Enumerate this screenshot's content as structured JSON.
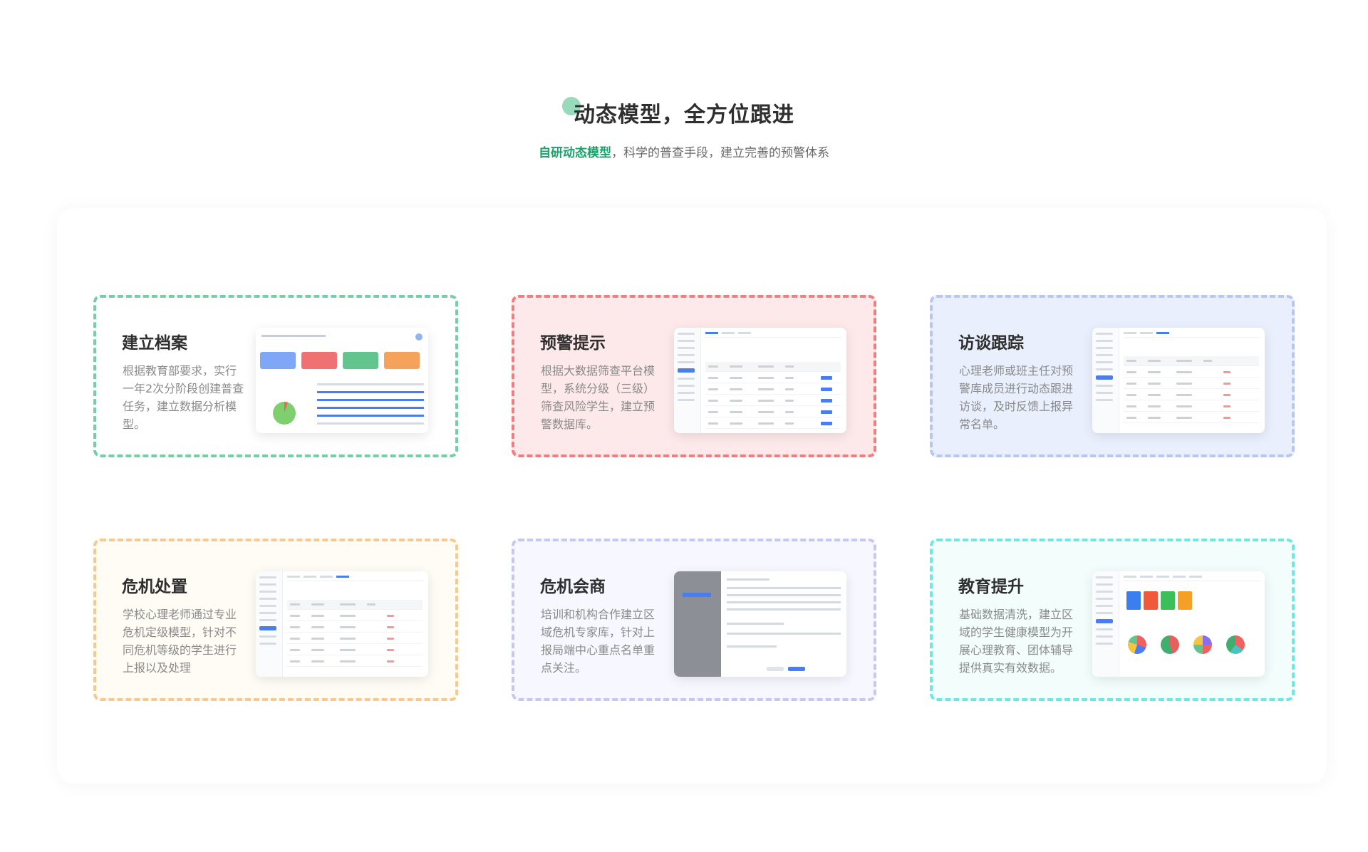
{
  "header": {
    "title": "动态模型，全方位跟进",
    "subtitle_highlight": "自研动态模型",
    "subtitle_rest": "，科学的普查手段，建立完善的预警体系"
  },
  "colors": {
    "accent_green": "#1aa06a",
    "card_borders": [
      "#74cfa7",
      "#f07e7e",
      "#b7c6f2",
      "#f8c98d",
      "#c6c8f3",
      "#6fe7e2"
    ]
  },
  "cards": [
    {
      "title": "建立档案",
      "desc": "根据教育部要求，实行一年2次分阶段创建普查任务，建立数据分析模型。"
    },
    {
      "title": "预警提示",
      "desc": "根据大数据筛查平台模型，系统分级（三级）筛查风险学生，建立预警数据库。"
    },
    {
      "title": "访谈跟踪",
      "desc": "心理老师或班主任对预警库成员进行动态跟进访谈，及时反馈上报异常名单。"
    },
    {
      "title": "危机处置",
      "desc": "学校心理老师通过专业危机定级模型，针对不同危机等级的学生进行上报以及处理"
    },
    {
      "title": "危机会商",
      "desc": "培训和机构合作建立区域危机专家库，针对上报局端中心重点名单重点关注。"
    },
    {
      "title": "教育提升",
      "desc": "基础数据清洗，建立区域的学生健康模型为开展心理教育、团体辅导提供真实有效数据。"
    }
  ]
}
